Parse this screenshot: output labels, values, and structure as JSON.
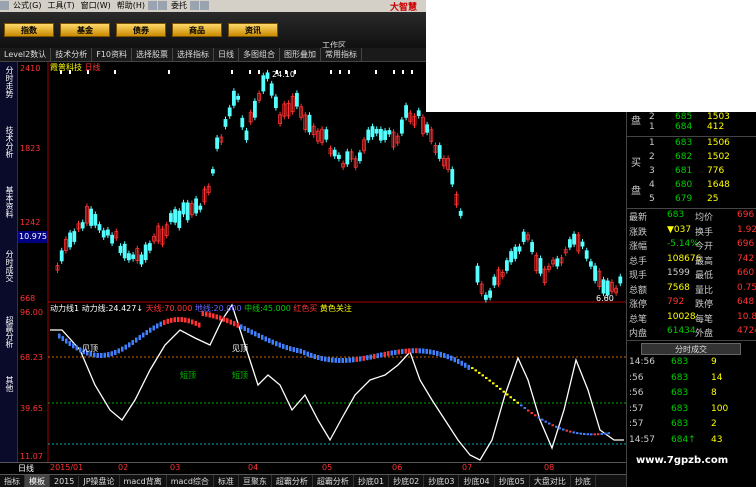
{
  "menubar": {
    "items": [
      "公式(G)",
      "工具(T)",
      "窗口(W)",
      "帮助(H)",
      "委托"
    ],
    "brand": "大智慧"
  },
  "nav": {
    "buttons": [
      "指数",
      "基金",
      "债券",
      "商品",
      "资讯"
    ],
    "workspace": "工作区"
  },
  "toolbar": {
    "items": [
      "Level2数认",
      "技术分析",
      "F10资料",
      "选择股票",
      "选择指标",
      "日线",
      "多图组合",
      "图形叠加",
      "常用指标"
    ]
  },
  "leftnav": {
    "tabs": [
      "分时走势",
      "技术分析",
      "基本资料",
      "分时成交",
      "超赢分析",
      "其他"
    ]
  },
  "kline": {
    "stock_name": "霞普科技",
    "period": "日线",
    "high_label": "24.10",
    "low_label": "6.60",
    "current_price": "10.975"
  },
  "price_axis": [
    "2410",
    "1823",
    "1242",
    "668"
  ],
  "indicator": {
    "title": "动力线1",
    "fields": [
      {
        "label": "动力线:",
        "value": "24.427↓"
      },
      {
        "label": "天线:",
        "value": "70.000"
      },
      {
        "label": "地线:",
        "value": "20.000"
      },
      {
        "label": "中线:",
        "value": "45.000"
      },
      {
        "label": "红色买",
        "value": ""
      },
      {
        "label": "黄色关注",
        "value": ""
      }
    ],
    "axis": [
      "96.00",
      "68.23",
      "39.65",
      "11.07"
    ],
    "tags": [
      "见顶",
      "见顶",
      "短顶",
      "短顶"
    ]
  },
  "dates": [
    "日线",
    "2015/01",
    "02",
    "03",
    "04",
    "05",
    "06",
    "07",
    "08"
  ],
  "tabs": [
    "指标",
    "模板",
    "2015",
    "JP操盘论",
    "macd背离",
    "macd综合",
    "标准",
    "亘聚东",
    "超霸分析",
    "超霸分析",
    "抄底01",
    "抄底02",
    "抄底03",
    "抄底04",
    "抄底05",
    "大盘对比",
    "抄底"
  ],
  "orderbook": {
    "sells": [
      {
        "lvl": "2",
        "price": "685",
        "vol": "1503"
      },
      {
        "lvl": "1",
        "price": "684",
        "vol": "412"
      }
    ],
    "buys": [
      {
        "lvl": "1",
        "price": "683",
        "vol": "1506"
      },
      {
        "lvl": "2",
        "price": "682",
        "vol": "1502"
      },
      {
        "lvl": "3",
        "price": "681",
        "vol": "776"
      },
      {
        "lvl": "4",
        "price": "680",
        "vol": "1648"
      },
      {
        "lvl": "5",
        "price": "679",
        "vol": "25"
      }
    ],
    "sell_label": "盘",
    "buy_label": "买盘"
  },
  "quote": [
    [
      "最新",
      "683",
      "均价",
      "696"
    ],
    [
      "涨跌",
      "▼037",
      "换手",
      "1.92%"
    ],
    [
      "涨幅",
      "-5.14%",
      "今开",
      "696"
    ],
    [
      "总手",
      "108676",
      "最高",
      "742"
    ],
    [
      "现手",
      "1599",
      "最低",
      "660"
    ],
    [
      "总额",
      "7568",
      "量比",
      "0.75"
    ],
    [
      "涨停",
      "792",
      "跌停",
      "648"
    ],
    [
      "总笔",
      "10028",
      "每笔",
      "10.8"
    ],
    [
      "内盘",
      "61434",
      "外盘",
      "47242"
    ]
  ],
  "fenshi": {
    "button": "分时成交",
    "ticks": [
      [
        "14:56",
        "683",
        "9",
        ""
      ],
      [
        ":56",
        "683",
        "14",
        ""
      ],
      [
        ":56",
        "683",
        "8",
        ""
      ],
      [
        ":57",
        "683",
        "100",
        ""
      ],
      [
        ":57",
        "683",
        "2",
        ""
      ],
      [
        "14:57",
        "684↑",
        "43",
        ""
      ]
    ]
  },
  "watermark": "www.7gpzb.com"
}
